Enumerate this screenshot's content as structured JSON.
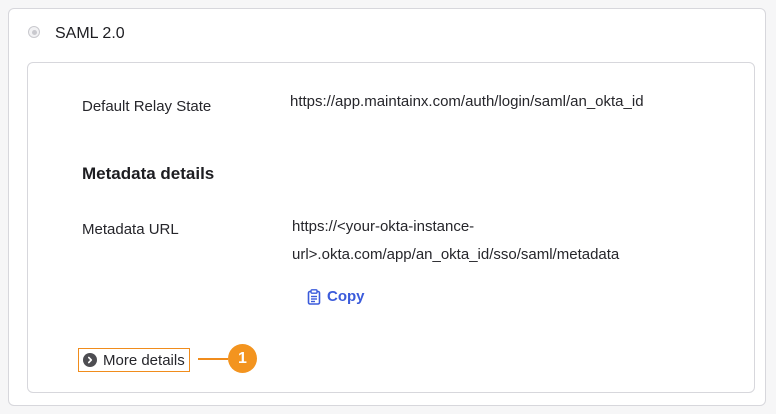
{
  "auth": {
    "option_label": "SAML 2.0"
  },
  "relay": {
    "label": "Default Relay State",
    "value": "https://app.maintainx.com/auth/login/saml/an_okta_id"
  },
  "metadata": {
    "section_title": "Metadata details",
    "url_label": "Metadata URL",
    "url_line1": "https://<your-okta-instance-",
    "url_line2": "url>.okta.com/app/an_okta_id/sso/saml/metadata",
    "copy_label": "Copy"
  },
  "more_details": {
    "label": "More details"
  },
  "callout": {
    "number": "1"
  },
  "colors": {
    "accent": "#3b5bdb",
    "callout": "#f3941f"
  },
  "icons": {
    "radio": "radio-icon",
    "copy": "clipboard-icon",
    "chevron": "chevron-right-circle-icon"
  }
}
